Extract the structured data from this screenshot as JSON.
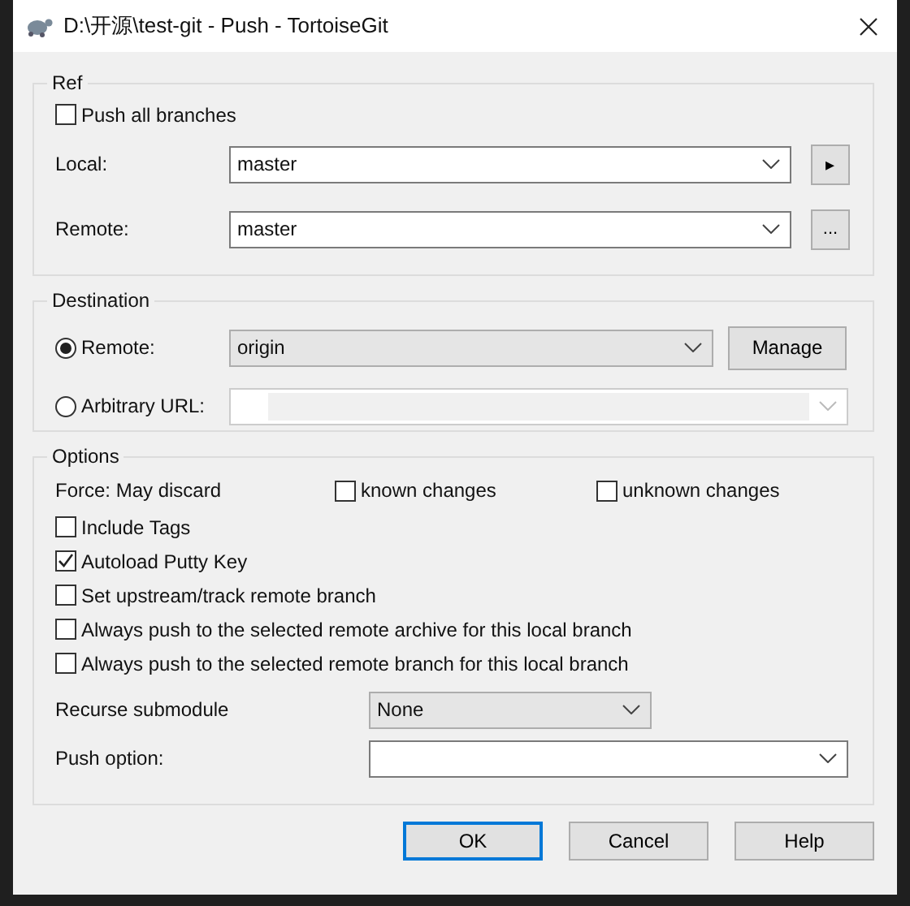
{
  "window": {
    "title": "D:\\开源\\test-git - Push - TortoiseGit"
  },
  "ref": {
    "title": "Ref",
    "push_all": {
      "label": "Push all branches",
      "checked": false
    },
    "local": {
      "label": "Local:",
      "value": "master",
      "button": "▸"
    },
    "remote": {
      "label": "Remote:",
      "value": "master",
      "button": "..."
    }
  },
  "destination": {
    "title": "Destination",
    "rows": [
      {
        "label": "Remote:",
        "selected": true,
        "value": "origin"
      },
      {
        "label": "Arbitrary URL:",
        "selected": false
      }
    ],
    "manage": "Manage"
  },
  "options": {
    "title": "Options",
    "force": {
      "label": "Force: May discard",
      "choices": [
        {
          "label": "known changes",
          "checked": false
        },
        {
          "label": "unknown changes",
          "checked": false
        }
      ]
    },
    "checkboxes": [
      {
        "label": "Include Tags",
        "checked": false
      },
      {
        "label": "Autoload Putty Key",
        "checked": true
      },
      {
        "label": "Set upstream/track remote branch",
        "checked": false
      },
      {
        "label": "Always push to the selected remote archive for this local branch",
        "checked": false
      },
      {
        "label": "Always push to the selected remote branch for this local branch",
        "checked": false
      }
    ],
    "recurse": {
      "label": "Recurse submodule",
      "value": "None"
    },
    "push_option": {
      "label": "Push option:"
    }
  },
  "buttons": [
    {
      "label": "OK",
      "default": true
    },
    {
      "label": "Cancel",
      "default": false
    },
    {
      "label": "Help",
      "default": false
    }
  ]
}
